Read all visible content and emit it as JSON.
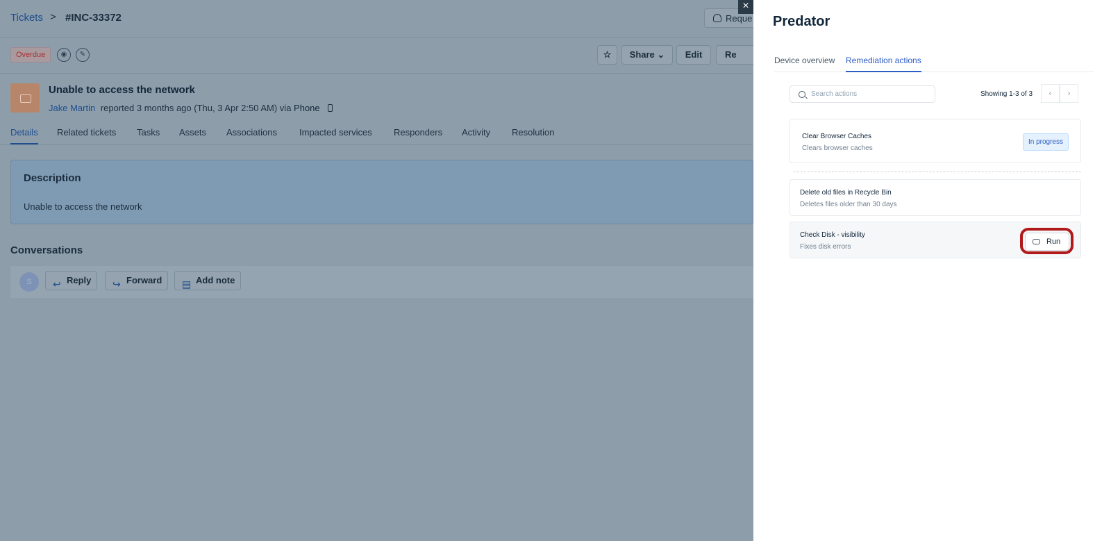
{
  "breadcrumb": {
    "root": "Tickets",
    "separator": ">",
    "ticket_id": "#INC-33372"
  },
  "topbar": {
    "request_button": "Reque"
  },
  "actionbar": {
    "status_badge": "Overdue",
    "share_label": "Share",
    "share_caret": "⌄",
    "edit_label": "Edit",
    "partial_label": "Re"
  },
  "ticket": {
    "subject": "Unable to access the network",
    "requester": "Jake Martin",
    "reported_text": "reported 3 months ago (Thu, 3 Apr 2:50 AM) via",
    "channel": "Phone"
  },
  "tabs": [
    "Details",
    "Related tickets",
    "Tasks",
    "Assets",
    "Associations",
    "Impacted services",
    "Responders",
    "Activity",
    "Resolution"
  ],
  "description": {
    "title": "Description",
    "text": "Unable to access the network"
  },
  "conversations": {
    "title": "Conversations",
    "avatar_initial": "S",
    "reply_label": "Reply",
    "forward_label": "Forward",
    "note_label": "Add note"
  },
  "panel": {
    "close_icon": "×",
    "title": "Predator",
    "tabs": [
      "Device overview",
      "Remediation actions"
    ],
    "active_tab": "Remediation actions",
    "search_placeholder": "Search actions",
    "showing": "Showing 1-3 of 3",
    "prev": "‹",
    "next": "›",
    "actions": [
      {
        "title": "Clear Browser Caches",
        "subtitle": "Clears browser caches",
        "status": "In progress"
      },
      {
        "title": "Delete old files in Recycle Bin",
        "subtitle": "Deletes files older than 30 days"
      },
      {
        "title": "Check Disk - visibility",
        "subtitle": "Fixes disk errors",
        "button": "Run"
      }
    ]
  },
  "colors": {
    "accent": "#2c5cc5",
    "highlight_ring": "#b11a1a",
    "overlay": "#8d9daa"
  }
}
